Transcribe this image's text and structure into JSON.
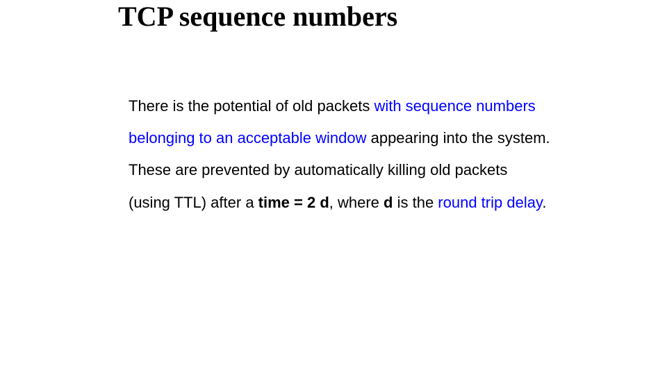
{
  "slide": {
    "title": "TCP sequence numbers",
    "body": {
      "p1a": "There is the potential of old packets ",
      "p1b": "with sequence numbers belonging to an acceptable window",
      "p1c": " appearing into the system. These are prevented by automatically killing old packets (using TTL) after a ",
      "p1d": "time = 2 d",
      "p1e": ", where ",
      "p1f": "d",
      "p1g": " is the ",
      "p1h": "round trip delay",
      "p1i": "."
    }
  }
}
